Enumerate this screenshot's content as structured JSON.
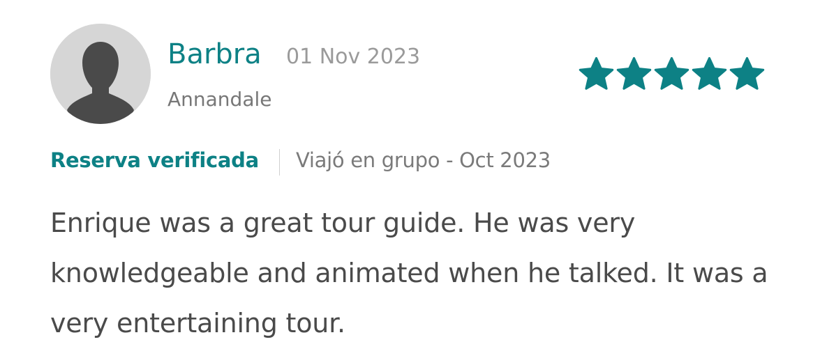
{
  "review": {
    "reviewer": {
      "name": "Barbra",
      "location": "Annandale",
      "avatar_icon": "default-user-silhouette-icon"
    },
    "date": "01 Nov 2023",
    "rating": {
      "stars": 5,
      "max": 5,
      "icon": "star-icon",
      "color": "#0d8185"
    },
    "verified_label": "Reserva verificada",
    "trip_info": "Viajó en grupo - Oct 2023",
    "text": "Enrique was a great tour guide. He was very knowledgeable and animated when he talked. It was a very entertaining tour."
  },
  "colors": {
    "accent": "#0d8185",
    "text": "#4a4a4a",
    "muted": "#9a9a9a",
    "avatar_bg": "#d6d6d6",
    "avatar_fg": "#4a4a4a"
  }
}
